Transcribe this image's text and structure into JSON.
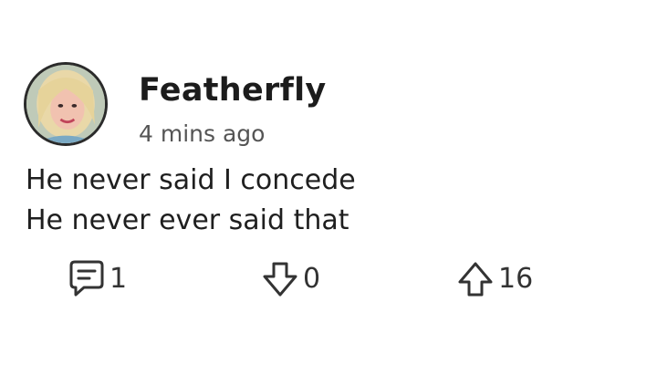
{
  "post": {
    "author": "Featherfly",
    "timestamp": "4 mins ago",
    "lines": [
      "He never said I concede",
      "He never ever said that"
    ]
  },
  "actions": {
    "comments": {
      "icon": "comment-icon",
      "count": "1"
    },
    "downvote": {
      "icon": "arrow-down-icon",
      "count": "0"
    },
    "upvote": {
      "icon": "arrow-up-icon",
      "count": "16"
    }
  },
  "colors": {
    "text": "#1f1f1f",
    "muted": "#555555",
    "icon": "#333333",
    "avatar_border": "#2b2b2b"
  }
}
